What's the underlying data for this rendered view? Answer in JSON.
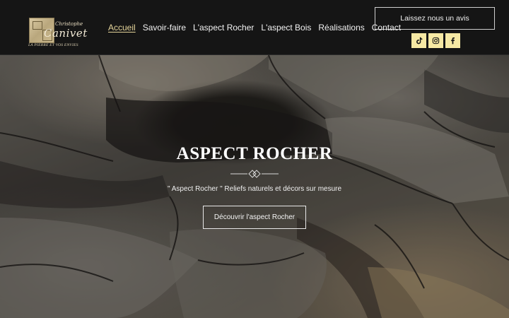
{
  "logo": {
    "script_small": "Christophe",
    "script_name": "Canivet",
    "tagline": "LA PIERRE ET VOS ENVIES"
  },
  "nav": {
    "items": [
      {
        "label": "Accueil",
        "active": true
      },
      {
        "label": "Savoir-faire",
        "active": false
      },
      {
        "label": "L'aspect Rocher",
        "active": false
      },
      {
        "label": "L'aspect Bois",
        "active": false
      },
      {
        "label": "Réalisations",
        "active": false
      },
      {
        "label": "Contact",
        "active": false
      }
    ]
  },
  "header": {
    "review_button": "Laissez nous un avis",
    "socials": [
      {
        "icon": "tiktok-icon"
      },
      {
        "icon": "instagram-icon"
      },
      {
        "icon": "facebook-icon"
      }
    ]
  },
  "hero": {
    "title": "ASPECT ROCHER",
    "subtitle": "\" Aspect Rocher \" Reliefs naturels et décors sur mesure",
    "cta": "Découvrir l'aspect Rocher"
  },
  "colors": {
    "header_bg": "#151515",
    "accent": "#e6d59b",
    "social_bg": "#f6e9a4"
  }
}
